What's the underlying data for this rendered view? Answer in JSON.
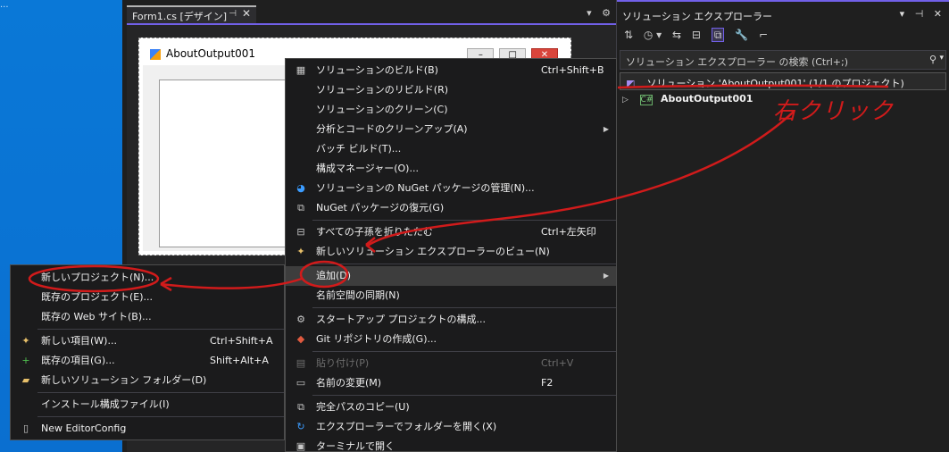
{
  "desktop": {
    "corner_text": "..."
  },
  "editor": {
    "tab_title": "Form1.cs [デザイン]",
    "tab_pin": "⊣",
    "tab_close": "✕",
    "tab_menu": "▾",
    "tab_settings": "⚙",
    "form_title": "AboutOutput001"
  },
  "solution_explorer": {
    "title": "ソリューション エクスプローラー",
    "search_placeholder": "ソリューション エクスプローラー の検索 (Ctrl+;)",
    "solution_node": "ソリューション 'AboutOutput001' (1/1 のプロジェクト)",
    "project_node": "AboutOutput001"
  },
  "main_menu": {
    "items": [
      {
        "label": "ソリューションのビルド(B)",
        "shortcut": "Ctrl+Shift+B"
      },
      {
        "label": "ソリューションのリビルド(R)",
        "shortcut": ""
      },
      {
        "label": "ソリューションのクリーン(C)",
        "shortcut": ""
      },
      {
        "label": "分析とコードのクリーンアップ(A)",
        "shortcut": ""
      },
      {
        "label": "バッチ ビルド(T)...",
        "shortcut": ""
      },
      {
        "label": "構成マネージャー(O)...",
        "shortcut": ""
      },
      {
        "label": "ソリューションの NuGet パッケージの管理(N)...",
        "shortcut": ""
      },
      {
        "label": "NuGet パッケージの復元(G)",
        "shortcut": ""
      },
      {
        "label": "すべての子孫を折りたたむ",
        "shortcut": "Ctrl+左矢印"
      },
      {
        "label": "新しいソリューション エクスプローラーのビュー(N)",
        "shortcut": ""
      },
      {
        "label": "追加(D)",
        "shortcut": ""
      },
      {
        "label": "名前空間の同期(N)",
        "shortcut": ""
      },
      {
        "label": "スタートアップ プロジェクトの構成...",
        "shortcut": ""
      },
      {
        "label": "Git リポジトリの作成(G)...",
        "shortcut": ""
      },
      {
        "label": "貼り付け(P)",
        "shortcut": "Ctrl+V"
      },
      {
        "label": "名前の変更(M)",
        "shortcut": "F2"
      },
      {
        "label": "完全パスのコピー(U)",
        "shortcut": ""
      },
      {
        "label": "エクスプローラーでフォルダーを開く(X)",
        "shortcut": ""
      },
      {
        "label": "ターミナルで開く",
        "shortcut": ""
      }
    ]
  },
  "sub_menu": {
    "items": [
      {
        "label": "新しいプロジェクト(N)...",
        "shortcut": ""
      },
      {
        "label": "既存のプロジェクト(E)...",
        "shortcut": ""
      },
      {
        "label": "既存の Web サイト(B)...",
        "shortcut": ""
      },
      {
        "label": "新しい項目(W)...",
        "shortcut": "Ctrl+Shift+A"
      },
      {
        "label": "既存の項目(G)...",
        "shortcut": "Shift+Alt+A"
      },
      {
        "label": "新しいソリューション フォルダー(D)",
        "shortcut": ""
      },
      {
        "label": "インストール構成ファイル(I)",
        "shortcut": ""
      },
      {
        "label": "New EditorConfig",
        "shortcut": ""
      }
    ]
  },
  "annotation": {
    "handwritten_text": "右クリック",
    "color": "#d11b1b"
  },
  "colors": {
    "accent": "#7160e8",
    "menu_bg": "#1b1b1c",
    "desktop": "#0a78d7"
  }
}
